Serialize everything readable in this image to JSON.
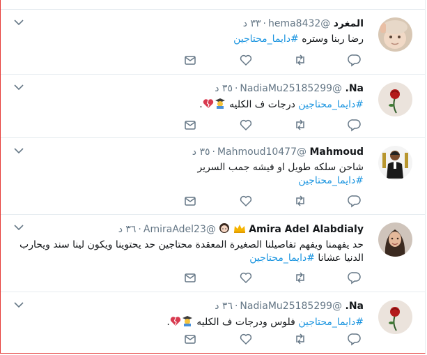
{
  "tweets": [
    {
      "name": "المغرد",
      "handle": "@hema8432",
      "time": "٣٣ د",
      "text": "رضا ربنا وستره",
      "hashtag": "#دايما_محتاجين",
      "text_after": "",
      "emojis": [],
      "avatar": "baby-photo"
    },
    {
      "name": "Na.",
      "handle": "@NadiaMu25185299",
      "time": "٣٥ د",
      "text": "",
      "hashtag": "#دايما_محتاجين",
      "text_after": " درجات ف الكليه ",
      "emojis": [
        "student-emoji",
        "broken-heart-emoji"
      ],
      "tail": ".",
      "avatar": "rose-photo"
    },
    {
      "name": "Mahmoud",
      "handle": "@Mahmoud10477",
      "time": "٣٥ د",
      "text": "شاحن سلكه طويل او فيشه جمب السرير",
      "hashtag": "#دايما_محتاجين",
      "avatar": "man-photo"
    },
    {
      "name": "Amira Adel Alabdialy",
      "handle": "@AmiraAdel23",
      "time": "٣٦ د",
      "text": "حد يفهمنا ويفهم تفاصيلنا الصغيرة المعقدة محتاجين حد يحتوينا ويكون لينا سند ويحارب الدنيا عشانا ",
      "hashtag": "#دايما_محتاجين",
      "name_emojis": [
        "crown-emoji",
        "girl-emoji"
      ],
      "avatar": "woman-photo"
    },
    {
      "name": "Na.",
      "handle": "@NadiaMu25185299",
      "time": "٣٦ د",
      "text": "",
      "hashtag": "#دايما_محتاجين",
      "text_after": " فلوس ودرجات ف الكليه ",
      "emojis": [
        "student-emoji",
        "broken-heart-emoji"
      ],
      "tail": ".",
      "avatar": "rose-photo"
    }
  ],
  "colors": {
    "hashtag": "#1b95e0",
    "name": "#14171a",
    "meta": "#657786",
    "icon": "#657786",
    "divider": "#e6ecf0"
  }
}
